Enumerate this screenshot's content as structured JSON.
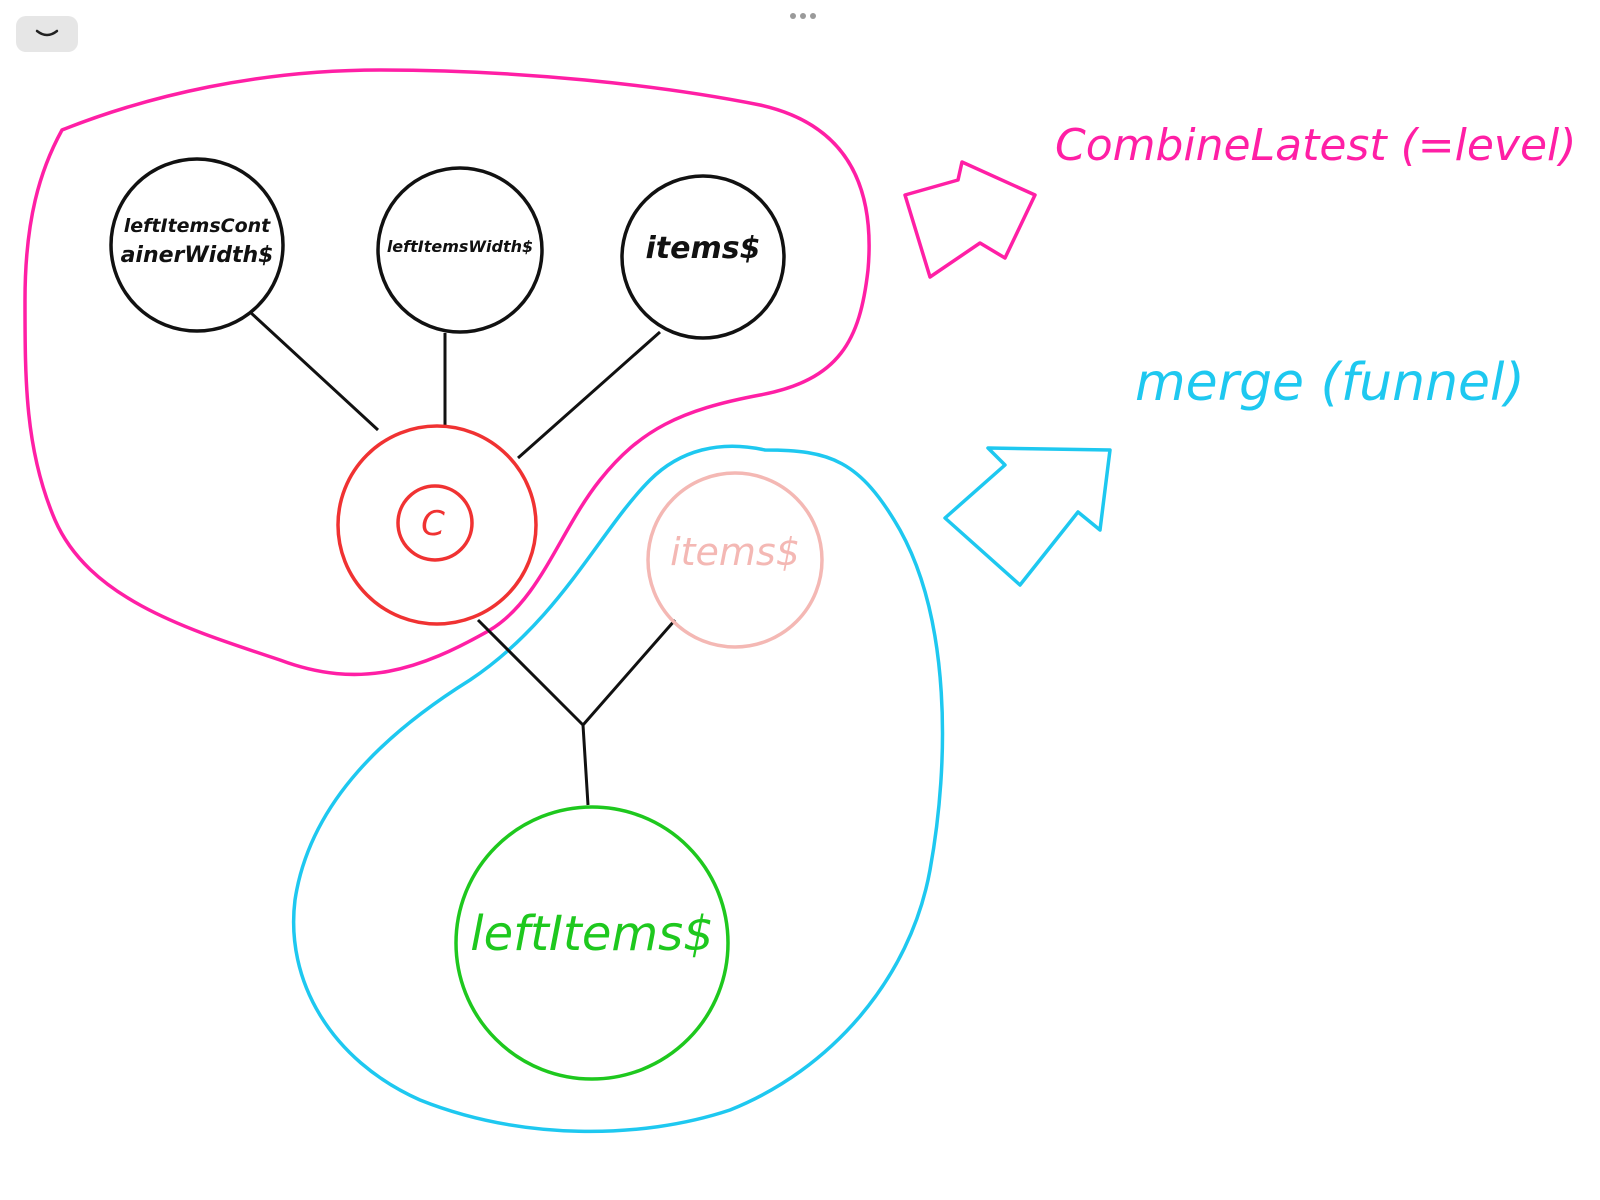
{
  "toolbar": {
    "collapse_icon": "chevron-down-icon",
    "more_icon": "more-dots-icon"
  },
  "colors": {
    "combine_group": "#ff1fa5",
    "merge_group": "#1ec8f0",
    "combine_node": "#f03232",
    "faded_node": "#f4b8b4",
    "result_node": "#1ec81e",
    "ink": "#111111"
  },
  "nodes": {
    "left_items_container_width_line1": "leftItemsCont",
    "left_items_container_width_line2": "ainerWidth$",
    "left_items_width": "leftItemsWidth$",
    "items": "items$",
    "combine_symbol": "C",
    "items_faded": "items$",
    "left_items": "leftItems$"
  },
  "annotations": {
    "combine_latest": "CombineLatest (=level)",
    "merge": "merge (funnel)"
  }
}
